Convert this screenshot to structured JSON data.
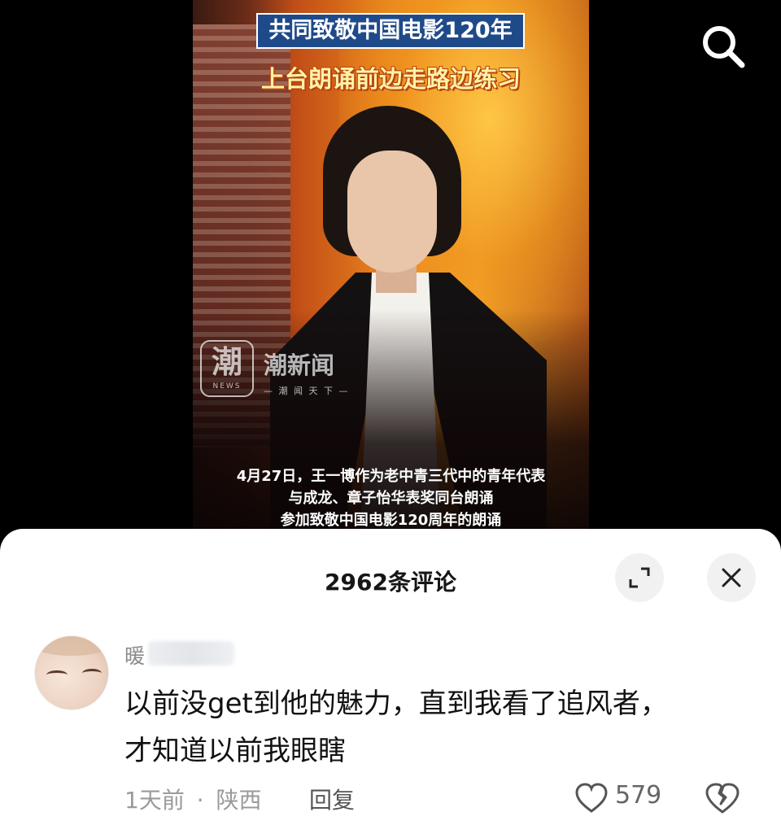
{
  "video": {
    "title_tag": "共同致敬中国电影120年",
    "subtitle_top": "上台朗诵前边走路边练习",
    "watermark_name": "潮新闻",
    "watermark_char": "潮",
    "watermark_news": "NEWS",
    "watermark_slogan": "— 潮 闻 天 下 —",
    "captions": [
      "4月27日，王一博作为老中青三代中的青年代表",
      "与成龙、章子怡华表奖同台朗诵",
      "参加致敬中国电影120周年的朗诵"
    ]
  },
  "icons": {
    "search": "search-icon",
    "expand": "expand-icon",
    "close": "close-icon",
    "like": "heart-icon",
    "dislike": "broken-heart-icon"
  },
  "comments_panel": {
    "title": "2962条评论"
  },
  "comment": {
    "username_visible": "暖",
    "text_line1": "以前没get到他的魅力，直到我看了追风者，",
    "text_line2": "才知道以前我眼瞎",
    "time": "1天前",
    "separator": "·",
    "location": "陕西",
    "reply_label": "回复",
    "likes": "579"
  },
  "colors": {
    "title_tag_bg": "#1f4a8a",
    "subtitle_text": "#fff2a8",
    "sheet_bg": "#ffffff",
    "meta_text": "#9a9a9a"
  }
}
